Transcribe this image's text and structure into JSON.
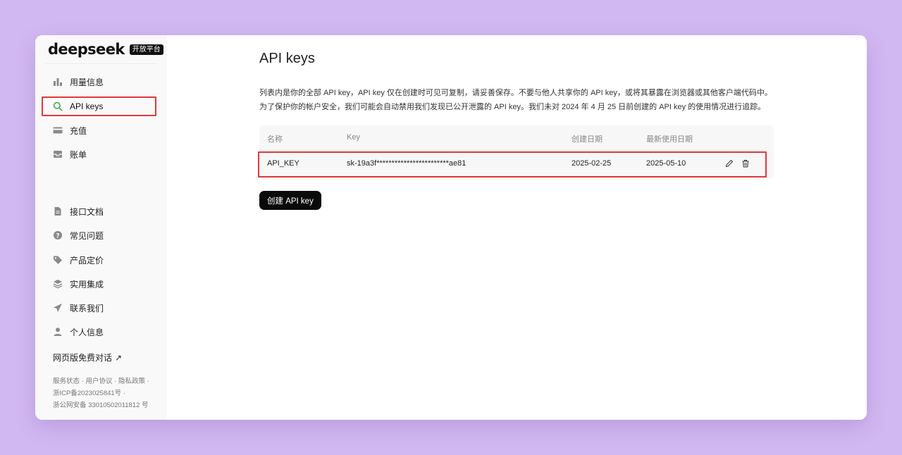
{
  "brand": {
    "logo": "deepseek",
    "badge": "开放平台"
  },
  "sidebar": {
    "top_items": [
      {
        "label": "用量信息",
        "icon": "bar-chart-icon"
      },
      {
        "label": "API keys",
        "icon": "search-key-icon"
      },
      {
        "label": "充值",
        "icon": "credit-card-icon"
      },
      {
        "label": "账单",
        "icon": "inbox-icon"
      }
    ],
    "bottom_items": [
      {
        "label": "接口文档",
        "icon": "document-icon"
      },
      {
        "label": "常见问题",
        "icon": "question-icon"
      },
      {
        "label": "产品定价",
        "icon": "tag-icon"
      },
      {
        "label": "实用集成",
        "icon": "layers-icon"
      },
      {
        "label": "联系我们",
        "icon": "send-icon"
      },
      {
        "label": "个人信息",
        "icon": "user-icon"
      }
    ],
    "free_chat": "网页版免费对话",
    "footer": {
      "service_status": "服务状态",
      "user_agreement": "用户协议",
      "privacy_policy": "隐私政策",
      "icp": "浙ICP备2023025841号",
      "police_record": "浙公网安备 33010502011812 号"
    }
  },
  "main": {
    "title": "API keys",
    "description_line1": "列表内是你的全部 API key，API key 仅在创建时可见可复制，请妥善保存。不要与他人共享你的 API key，或将其暴露在浏览器或其他客户端代码中。",
    "description_line2": "为了保护你的帐户安全，我们可能会自动禁用我们发现已公开泄露的 API key。我们未对 2024 年 4 月 25 日前创建的 API key 的使用情况进行追踪。",
    "table": {
      "headers": {
        "name": "名称",
        "key": "Key",
        "created": "创建日期",
        "last_used": "最新使用日期"
      },
      "rows": [
        {
          "name": "API_KEY",
          "key": "sk-19a3f************************ae81",
          "created": "2025-02-25",
          "last_used": "2025-05-10"
        }
      ]
    },
    "create_button": "创建 API key"
  },
  "colors": {
    "highlight": "#e0393b",
    "background": "#d2b8f2",
    "button": "#0a0a0a"
  }
}
